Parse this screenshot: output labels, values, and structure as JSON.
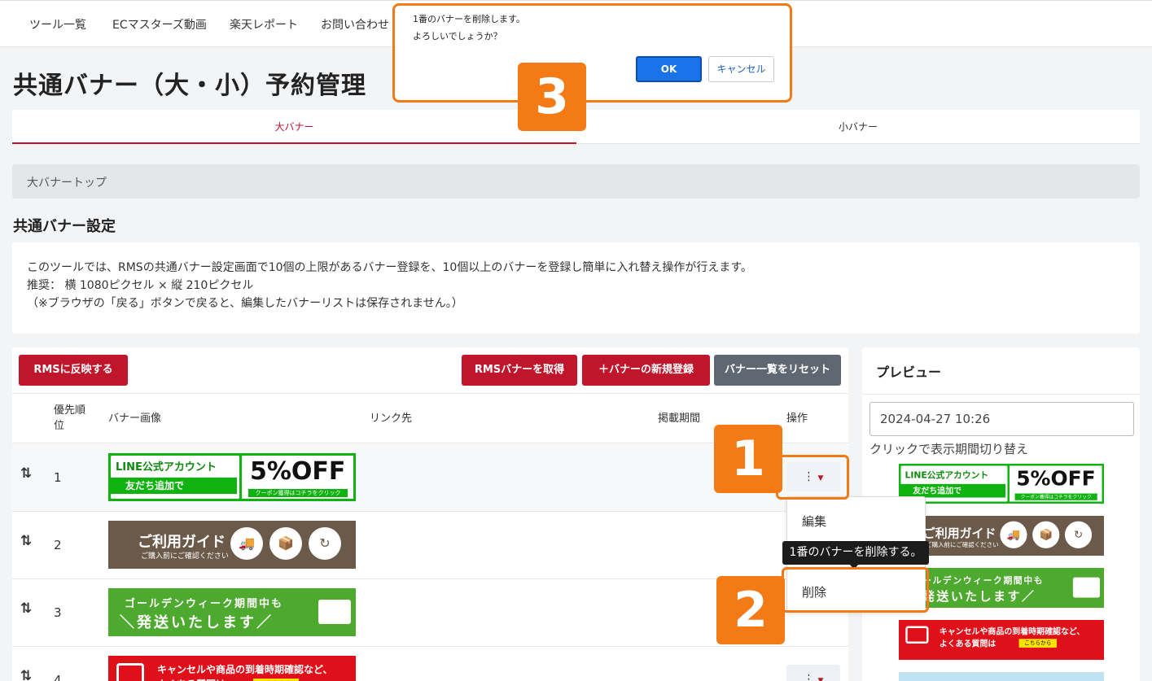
{
  "nav": {
    "items": [
      "ツール一覧",
      "ECマスターズ動画",
      "楽天レポート",
      "お問い合わせ"
    ]
  },
  "page_title": "共通バナー（大・小）予約管理",
  "tabs": [
    {
      "label": "大バナー",
      "active": true
    },
    {
      "label": "小バナー",
      "active": false
    }
  ],
  "breadcrumb": "大バナートップ",
  "section_title": "共通バナー設定",
  "description": [
    "このツールでは、RMSの共通バナー設定画面で10個の上限があるバナー登録を、10個以上のバナーを登録し簡単に入れ替え操作が行えます。",
    "推奨： 横 1080ピクセル × 縦 210ピクセル",
    "（※ブラウザの「戻る」ボタンで戻ると、編集したバナーリストは保存されません。）"
  ],
  "toolbar": {
    "apply_rms": "RMSに反映する",
    "get_rms": "RMSバナーを取得",
    "new_banner": "＋バナーの新規登録",
    "reset_list": "バナー一覧をリセット"
  },
  "table": {
    "headers": {
      "priority": "優先順位",
      "image": "バナー画像",
      "link": "リンク先",
      "period": "掲載期間",
      "actions": "操作"
    },
    "rows": [
      {
        "priority": "1",
        "banner": "line"
      },
      {
        "priority": "2",
        "banner": "guide"
      },
      {
        "priority": "3",
        "banner": "gw"
      },
      {
        "priority": "4",
        "banner": "inquiry"
      }
    ]
  },
  "banners": {
    "line": {
      "title": "LINE公式アカウント",
      "cta": "友だち追加で",
      "badge": "LINE",
      "discount": "5%OFF",
      "note": "クーポン獲得はコチラをクリック"
    },
    "guide": {
      "title": "ご利用ガイド",
      "sub": "ご購入前にご確認ください"
    },
    "gw": {
      "line1": "ゴールデンウィーク期間中も",
      "line2": "＼発送いたします／"
    },
    "inquiry": {
      "line1": "キャンセルや商品の到着時期確認など、",
      "line2": "よくある質問は",
      "button": "こちらから"
    }
  },
  "preview": {
    "title": "プレビュー",
    "datetime": "2024-04-27 10:26",
    "hint": "クリックで表示期間切り替え"
  },
  "dropdown": {
    "edit": "編集",
    "delete": "削除",
    "tooltip": "1番のバナーを削除する。"
  },
  "dialog": {
    "line1": "1番のバナーを削除します。",
    "line2": "よろしいでしょうか？",
    "ok": "OK",
    "cancel": "キャンセル"
  },
  "annotations": [
    "1",
    "2",
    "3"
  ],
  "colors": {
    "accent": "#c0162b",
    "highlight": "#f47a16",
    "ok_button": "#1a73e8"
  }
}
